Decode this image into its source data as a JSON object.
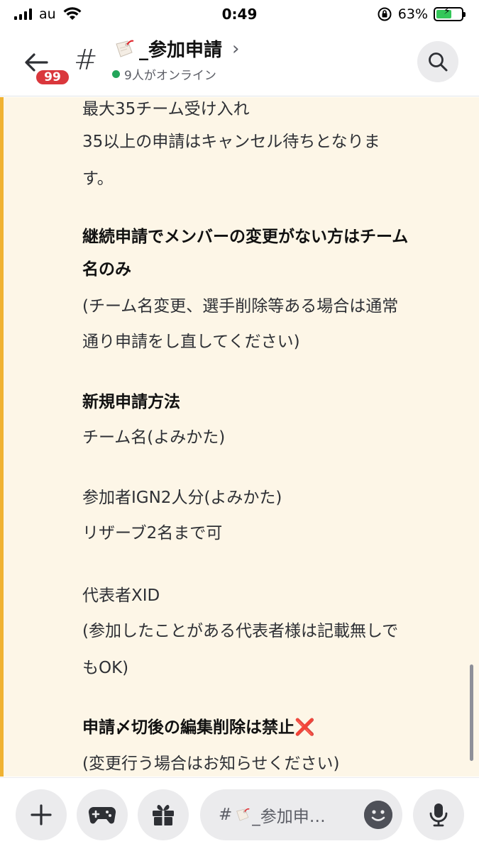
{
  "status_bar": {
    "carrier": "au",
    "time": "0:49",
    "battery_percent": "63%",
    "battery_level": 0.63
  },
  "header": {
    "unread_badge": "99",
    "channel_prefix": "#",
    "channel_name": "_参加申請",
    "online_status": "9人がオンライン"
  },
  "messages": [
    {
      "text": "最大35チーム受け入れ",
      "bold": false
    },
    {
      "text": "35以上の申請はキャンセル待ちとなりま",
      "bold": false
    },
    {
      "text": "す。",
      "bold": false
    },
    {
      "text": "継続申請でメンバーの変更がない方はチーム",
      "bold": true
    },
    {
      "text": "名のみ",
      "bold": true
    },
    {
      "text": "(チーム名変更、選手削除等ある場合は通常",
      "bold": false
    },
    {
      "text": "通り申請をし直してください)",
      "bold": false
    },
    {
      "text": "新規申請方法",
      "bold": true
    },
    {
      "text": "チーム名(よみかた)",
      "bold": false
    },
    {
      "text": "参加者IGN2人分(よみかた)",
      "bold": false
    },
    {
      "text": "リザーブ2名まで可",
      "bold": false
    },
    {
      "text": "代表者XID",
      "bold": false
    },
    {
      "text": "(参加したことがある代表者様は記載無しで",
      "bold": false
    },
    {
      "text": "もOK)",
      "bold": false
    },
    {
      "text": "申請〆切後の編集削除は禁止",
      "bold": true,
      "emoji": "❌"
    },
    {
      "text": "(変更行う場合はお知らせください)",
      "bold": false
    }
  ],
  "composer": {
    "placeholder_prefix": "#",
    "placeholder_text": "_参加申…"
  },
  "colors": {
    "mention_highlight": "#fdf6e7",
    "mention_bar": "#f0b232",
    "badge_red": "#da373c",
    "online_green": "#23a55a"
  }
}
